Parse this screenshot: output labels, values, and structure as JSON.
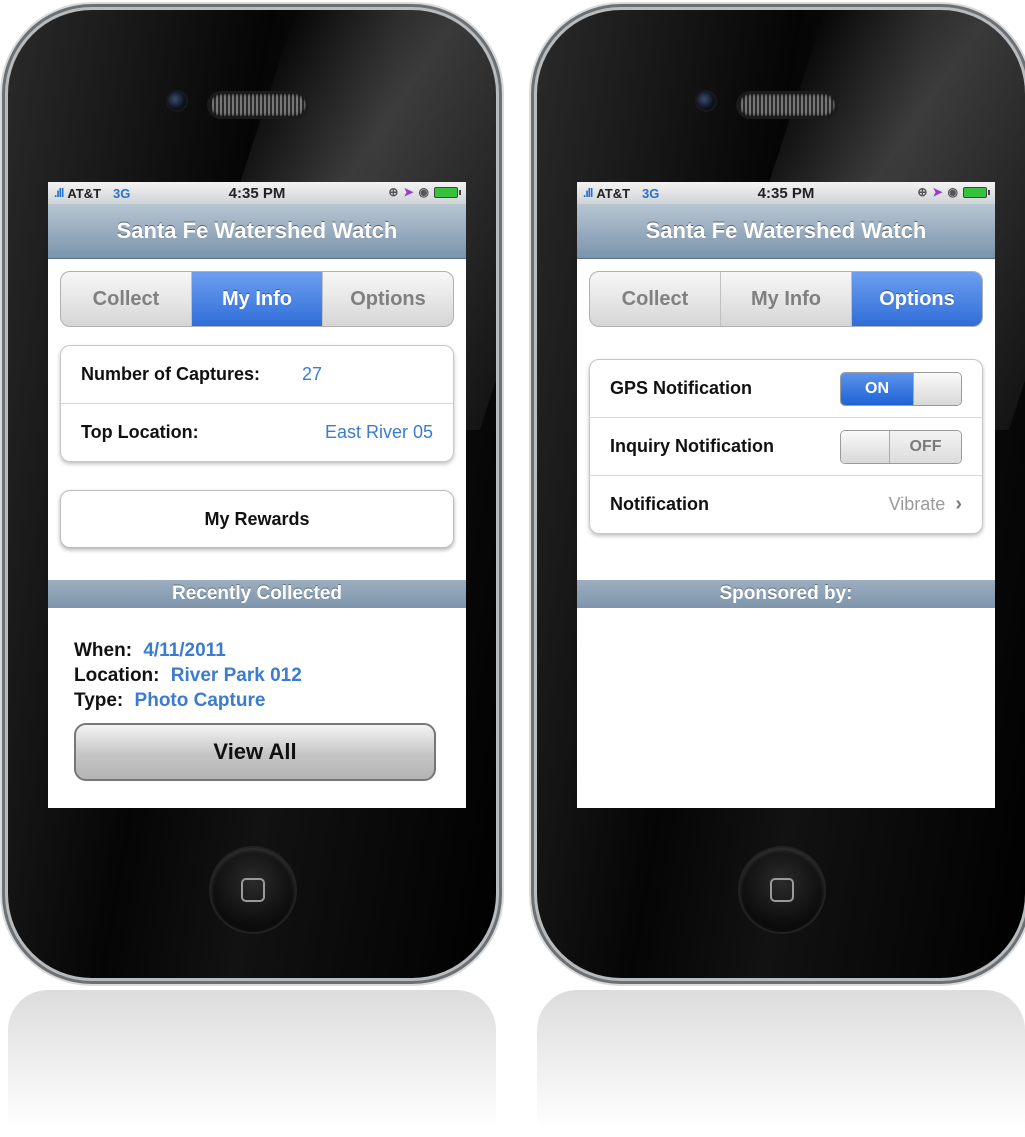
{
  "status_bar": {
    "carrier": "AT&T",
    "network": "3G",
    "time": "4:35 PM"
  },
  "app": {
    "title": "Santa Fe Watershed Watch"
  },
  "tabs": [
    {
      "label": "Collect"
    },
    {
      "label": "My Info"
    },
    {
      "label": "Options"
    }
  ],
  "my_info": {
    "captures_label": "Number of Captures:",
    "captures_value": "27",
    "location_label": "Top Location:",
    "location_value": "East River 05",
    "rewards_button": "My Rewards",
    "recent_header": "Recently Collected",
    "recent": {
      "when_label": "When:",
      "when_value": "4/11/2011",
      "location_label": "Location:",
      "location_value": "River Park 012",
      "type_label": "Type:",
      "type_value": "Photo Capture"
    },
    "view_all_button": "View All"
  },
  "options": {
    "gps_label": "GPS Notification",
    "gps_state": "ON",
    "inquiry_label": "Inquiry Notification",
    "inquiry_state": "OFF",
    "notification_label": "Notification",
    "notification_value": "Vibrate",
    "sponsor_header": "Sponsored by:"
  },
  "colors": {
    "accent": "#2f6ed8",
    "value_text": "#3b7bd0",
    "nav_bar": "#8aa2b9"
  }
}
